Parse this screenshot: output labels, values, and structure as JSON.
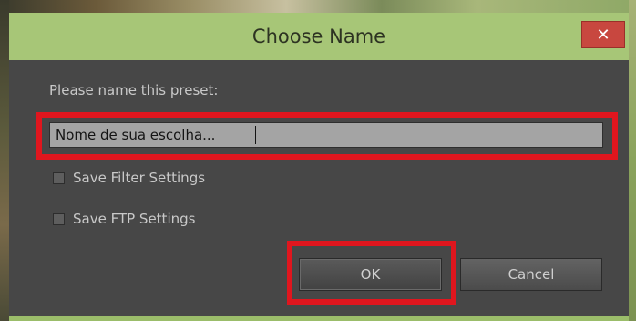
{
  "window": {
    "title": "Choose Name",
    "close_glyph": "✕"
  },
  "form": {
    "prompt": "Please name this preset:",
    "name_value": "Nome de sua escolha...",
    "checkboxes": [
      {
        "label": "Save Filter Settings",
        "checked": false
      },
      {
        "label": "Save FTP Settings",
        "checked": false
      }
    ]
  },
  "buttons": {
    "ok_label": "OK",
    "cancel_label": "Cancel"
  },
  "colors": {
    "titlebar": "#a7c677",
    "dialog_bg": "#474747",
    "highlight": "#e0161e",
    "close_button": "#c8473f"
  }
}
